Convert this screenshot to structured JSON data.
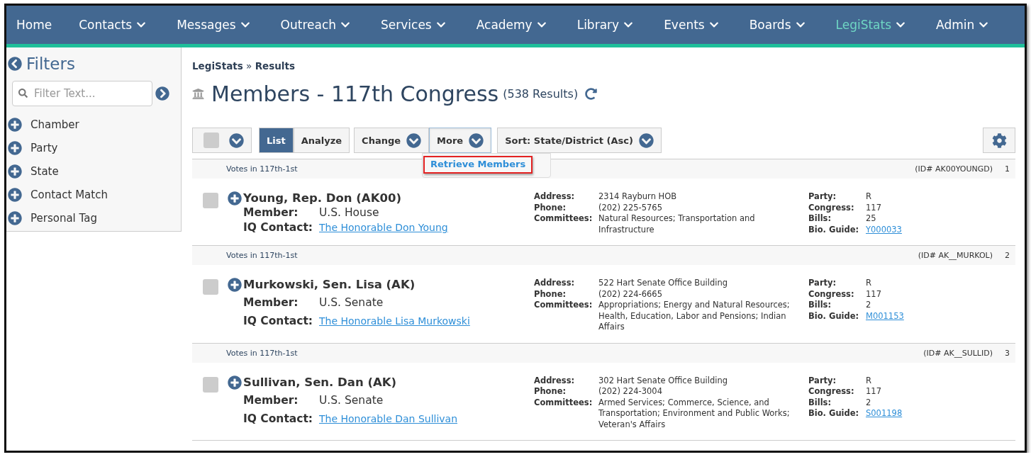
{
  "nav": [
    {
      "label": "Home",
      "has_menu": false,
      "selected": false
    },
    {
      "label": "Contacts",
      "has_menu": true,
      "selected": false
    },
    {
      "label": "Messages",
      "has_menu": true,
      "selected": false
    },
    {
      "label": "Outreach",
      "has_menu": true,
      "selected": false
    },
    {
      "label": "Services",
      "has_menu": true,
      "selected": false
    },
    {
      "label": "Academy",
      "has_menu": true,
      "selected": false
    },
    {
      "label": "Library",
      "has_menu": true,
      "selected": false
    },
    {
      "label": "Events",
      "has_menu": true,
      "selected": false
    },
    {
      "label": "Boards",
      "has_menu": true,
      "selected": false
    },
    {
      "label": "LegiStats",
      "has_menu": true,
      "selected": true
    },
    {
      "label": "Admin",
      "has_menu": true,
      "selected": false
    }
  ],
  "sidebar": {
    "title": "Filters",
    "search": {
      "placeholder": "Filter Text..."
    },
    "filters": [
      {
        "label": "Chamber"
      },
      {
        "label": "Party"
      },
      {
        "label": "State"
      },
      {
        "label": "Contact Match"
      },
      {
        "label": "Personal Tag"
      }
    ]
  },
  "breadcrumb": "**LegiStats** » **Results**",
  "title": "Members - 117th Congress",
  "result_count": "(538 Results)",
  "toolbar": {
    "select_all": {
      "checked": false
    },
    "views": [
      {
        "label": "List",
        "selected": true
      },
      {
        "label": "Analyze",
        "selected": false
      }
    ],
    "buttons": [
      {
        "label": "Change",
        "open": false
      },
      {
        "label": "More",
        "open": true
      }
    ],
    "sort": "Sort: State/District (Asc)",
    "menu": [
      {
        "label": "Retrieve Members",
        "highlighted": true
      }
    ]
  },
  "records": [
    {
      "header": "Votes in 117th-1st",
      "id": "(ID# AK00YOUNGD)",
      "index": "1",
      "checked": false,
      "name": "Young, Rep. Don (AK00)",
      "member_label": "Member:",
      "member": "U.S. House",
      "contact_label": "IQ Contact:",
      "contact": "The Honorable Don Young",
      "details": [
        {
          "label": "Address:",
          "value": "2314 Rayburn HOB"
        },
        {
          "label": "Phone:",
          "value": "(202) 225-5765"
        },
        {
          "label": "Committees:",
          "value": "Natural Resources; Transportation and Infrastructure"
        }
      ],
      "facts": [
        {
          "label": "Party:",
          "value": "R",
          "kind": "text"
        },
        {
          "label": "Congress:",
          "value": "117",
          "kind": "text"
        },
        {
          "label": "Bills:",
          "value": "25",
          "kind": "text"
        },
        {
          "label": "Bio. Guide:",
          "value": "Y000033",
          "kind": "link"
        }
      ]
    },
    {
      "header": "Votes in 117th-1st",
      "id": "(ID# AK__MURKOL)",
      "index": "2",
      "checked": false,
      "name": "Murkowski, Sen. Lisa (AK)",
      "member_label": "Member:",
      "member": "U.S. Senate",
      "contact_label": "IQ Contact:",
      "contact": "The Honorable Lisa Murkowski",
      "details": [
        {
          "label": "Address:",
          "value": "522 Hart Senate Office Building"
        },
        {
          "label": "Phone:",
          "value": "(202) 224-6665"
        },
        {
          "label": "Committees:",
          "value": "Appropriations; Energy and Natural Resources; Health, Education, Labor and Pensions; Indian Affairs"
        }
      ],
      "facts": [
        {
          "label": "Party:",
          "value": "R",
          "kind": "text"
        },
        {
          "label": "Congress:",
          "value": "117",
          "kind": "text"
        },
        {
          "label": "Bills:",
          "value": "2",
          "kind": "text"
        },
        {
          "label": "Bio. Guide:",
          "value": "M001153",
          "kind": "link"
        }
      ]
    },
    {
      "header": "Votes in 117th-1st",
      "id": "(ID# AK__SULLID)",
      "index": "3",
      "checked": false,
      "name": "Sullivan, Sen. Dan (AK)",
      "member_label": "Member:",
      "member": "U.S. Senate",
      "contact_label": "IQ Contact:",
      "contact": "The Honorable Dan Sullivan",
      "details": [
        {
          "label": "Address:",
          "value": "302 Hart Senate Office Building"
        },
        {
          "label": "Phone:",
          "value": "(202) 224-3004"
        },
        {
          "label": "Committees:",
          "value": "Armed Services; Commerce, Science, and Transportation; Environment and Public Works; Veteran's Affairs"
        }
      ],
      "facts": [
        {
          "label": "Party:",
          "value": "R",
          "kind": "text"
        },
        {
          "label": "Congress:",
          "value": "117",
          "kind": "text"
        },
        {
          "label": "Bills:",
          "value": "2",
          "kind": "text"
        },
        {
          "label": "Bio. Guide:",
          "value": "S001198",
          "kind": "link"
        }
      ]
    }
  ]
}
